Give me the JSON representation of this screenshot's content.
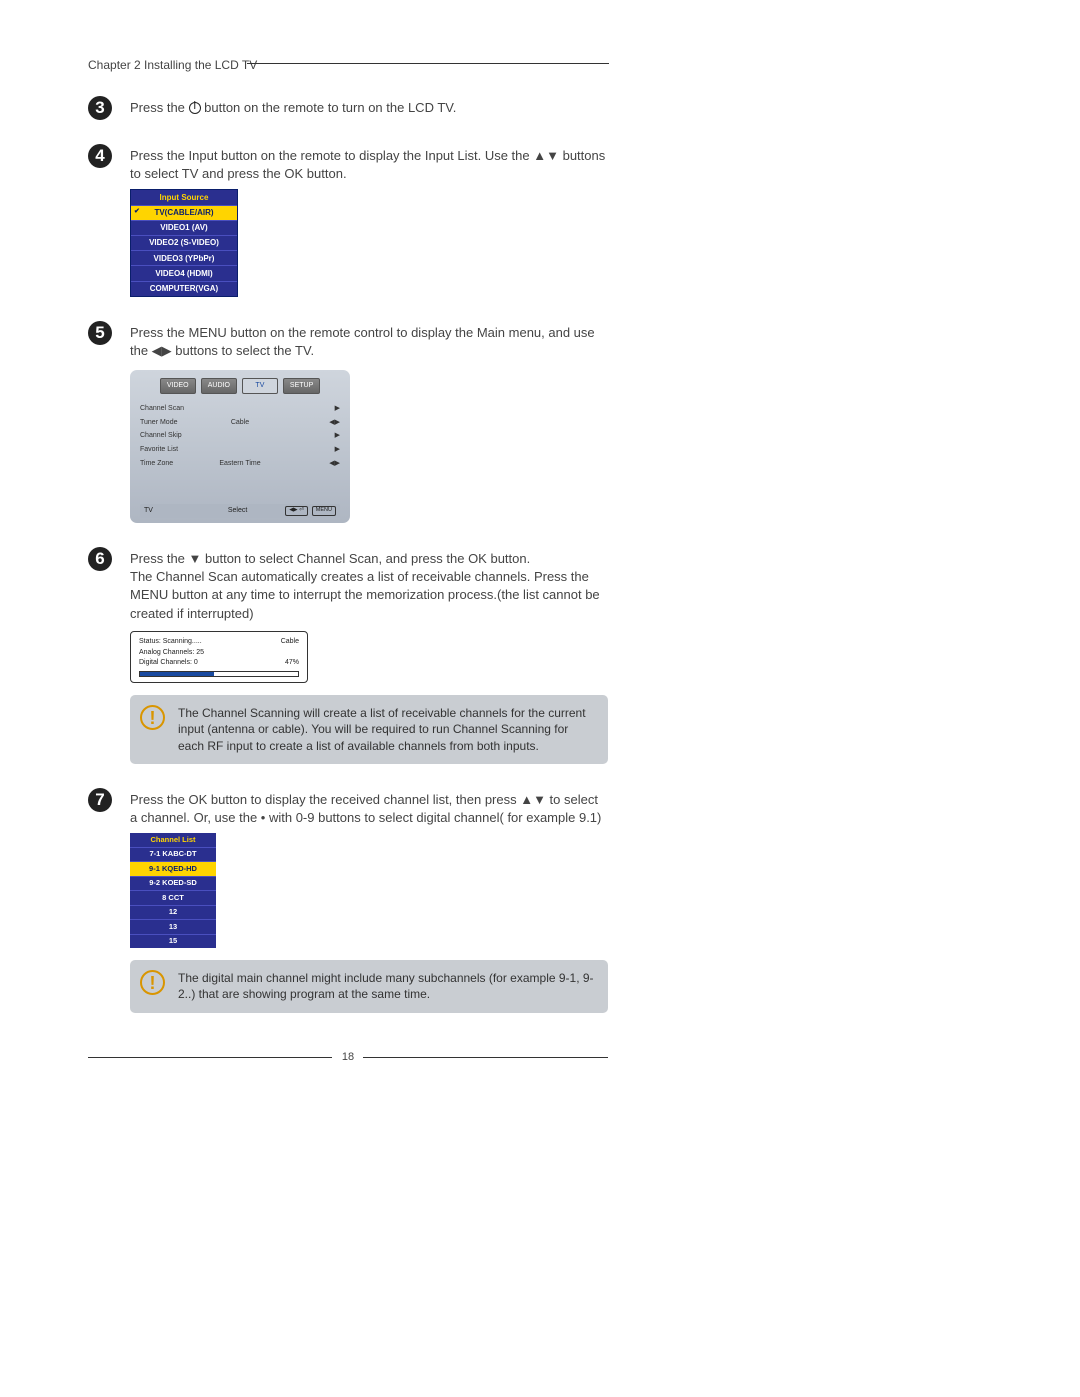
{
  "chapter_header": "Chapter 2 Installing the LCD TV",
  "step3": {
    "num": "3",
    "text_a": "Press the ",
    "text_b": " button on the remote to turn on the LCD TV."
  },
  "step4": {
    "num": "4",
    "text": "Press the Input button on the remote to display the Input List. Use the ▲▼ buttons to select TV and press the OK button.",
    "input_source": {
      "title": "Input Source",
      "items": [
        "TV(CABLE/AIR)",
        "VIDEO1 (AV)",
        "VIDEO2 (S-VIDEO)",
        "VIDEO3 (YPbPr)",
        "VIDEO4 (HDMI)",
        "COMPUTER(VGA)"
      ]
    }
  },
  "step5": {
    "num": "5",
    "text": "Press the MENU button on the remote control to display the Main menu, and use the ◀▶ buttons to select the TV.",
    "menu": {
      "tabs": [
        "VIDEO",
        "AUDIO",
        "TV",
        "SETUP"
      ],
      "rows": [
        {
          "lbl": "Channel Scan",
          "val": "",
          "arrow": "▶"
        },
        {
          "lbl": "Tuner Mode",
          "val": "Cable",
          "arrow": "◀▶"
        },
        {
          "lbl": "Channel Skip",
          "val": "",
          "arrow": "▶"
        },
        {
          "lbl": "Favorite List",
          "val": "",
          "arrow": "▶"
        },
        {
          "lbl": "Time Zone",
          "val": "Eastern Time",
          "arrow": "◀▶"
        }
      ],
      "footer": {
        "left": "TV",
        "center": "Select",
        "btns": [
          "◀▶ ⏎",
          "MENU"
        ]
      }
    }
  },
  "step6": {
    "num": "6",
    "text": "Press the ▼ button to select Channel Scan, and press the OK button.\nThe Channel Scan automatically creates a list of receivable channels. Press the MENU button at any time to interrupt the memorization process.(the list cannot be created if interrupted)",
    "scan": {
      "status_label": "Status: Scanning.....",
      "status_val": "Cable",
      "analog_label": "Analog Channels: 25",
      "digital_label": "Digital Channels: 0",
      "progress": "47%"
    },
    "note": "The Channel Scanning will create a list of receivable channels for the current input (antenna or cable). You will be required to run Channel Scanning for each RF input to create a list of available channels from both inputs."
  },
  "step7": {
    "num": "7",
    "text": "Press the OK button to display the received channel list, then press ▲▼ to select a channel. Or, use the • with 0-9 buttons to select digital channel( for example 9.1)",
    "channel_list": {
      "title": "Channel List",
      "items": [
        "7-1 KABC-DT",
        "9-1 KQED-HD",
        "9-2 KOED-SD",
        "8     CCT",
        "12",
        "13",
        "15"
      ]
    },
    "note": "The digital main channel might include many subchannels (for example 9-1, 9-2..) that are showing program at the same time."
  },
  "page_number": "18"
}
